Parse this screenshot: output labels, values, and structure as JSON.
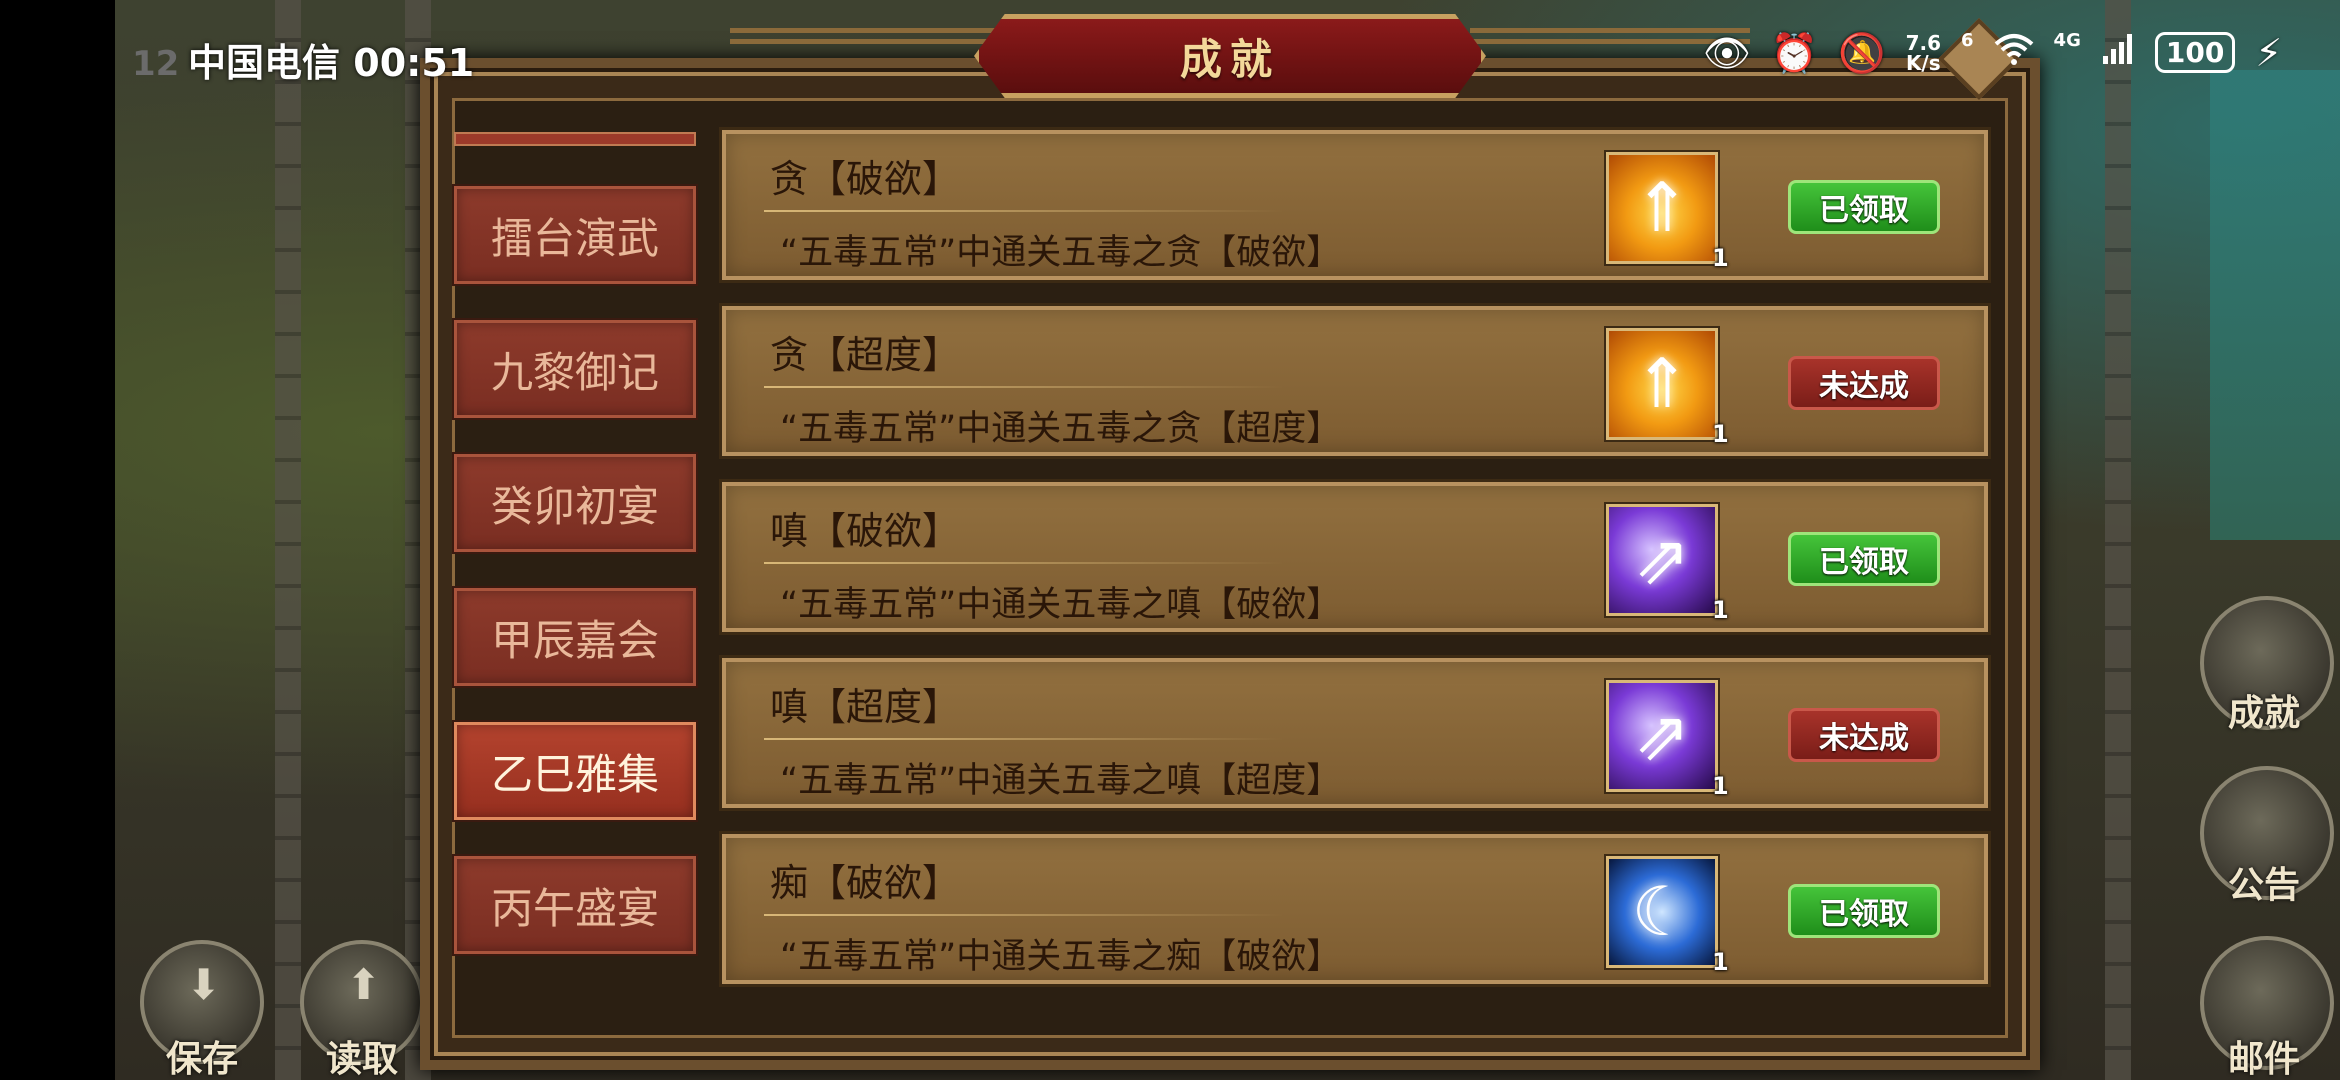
{
  "status_bar": {
    "carrier": "中国电信",
    "time": "00:51",
    "hud_corner": "12",
    "net_speed_value": "7.6",
    "net_speed_unit": "K/s",
    "net_tag": "6",
    "net_tag2": "4G",
    "battery": "100"
  },
  "dialog": {
    "title": "成就"
  },
  "tabs": [
    {
      "label": "擂台演武",
      "active": false
    },
    {
      "label": "九黎御记",
      "active": false
    },
    {
      "label": "癸卯初宴",
      "active": false
    },
    {
      "label": "甲辰嘉会",
      "active": false
    },
    {
      "label": "乙巳雅集",
      "active": true
    },
    {
      "label": "丙午盛宴",
      "active": false
    }
  ],
  "achievements": [
    {
      "title": "贪【破欲】",
      "description": "“五毒五常”中通关五毒之贪【破欲】",
      "reward_icon": "flame-arrow-icon",
      "reward_count": "1",
      "status": "已领取"
    },
    {
      "title": "贪【超度】",
      "description": "“五毒五常”中通关五毒之贪【超度】",
      "reward_icon": "flame-arrow-icon",
      "reward_count": "1",
      "status": "未达成"
    },
    {
      "title": "嗔【破欲】",
      "description": "“五毒五常”中通关五毒之嗔【破欲】",
      "reward_icon": "arcane-arrow-icon",
      "reward_count": "1",
      "status": "已领取"
    },
    {
      "title": "嗔【超度】",
      "description": "“五毒五常”中通关五毒之嗔【超度】",
      "reward_icon": "arcane-arrow-icon",
      "reward_count": "1",
      "status": "未达成"
    },
    {
      "title": "痴【破欲】",
      "description": "“五毒五常”中通关五毒之痴【破欲】",
      "reward_icon": "crescent-moon-icon",
      "reward_count": "1",
      "status": "已领取"
    }
  ],
  "side_hud": {
    "achievements_label": "成就",
    "notice_label": "公告",
    "mail_label": "邮件",
    "save_label": "保存",
    "load_label": "读取"
  },
  "colors": {
    "claimed": "#2fa62a",
    "unachieved": "#8f2620",
    "title_banner": "#7a1414"
  }
}
